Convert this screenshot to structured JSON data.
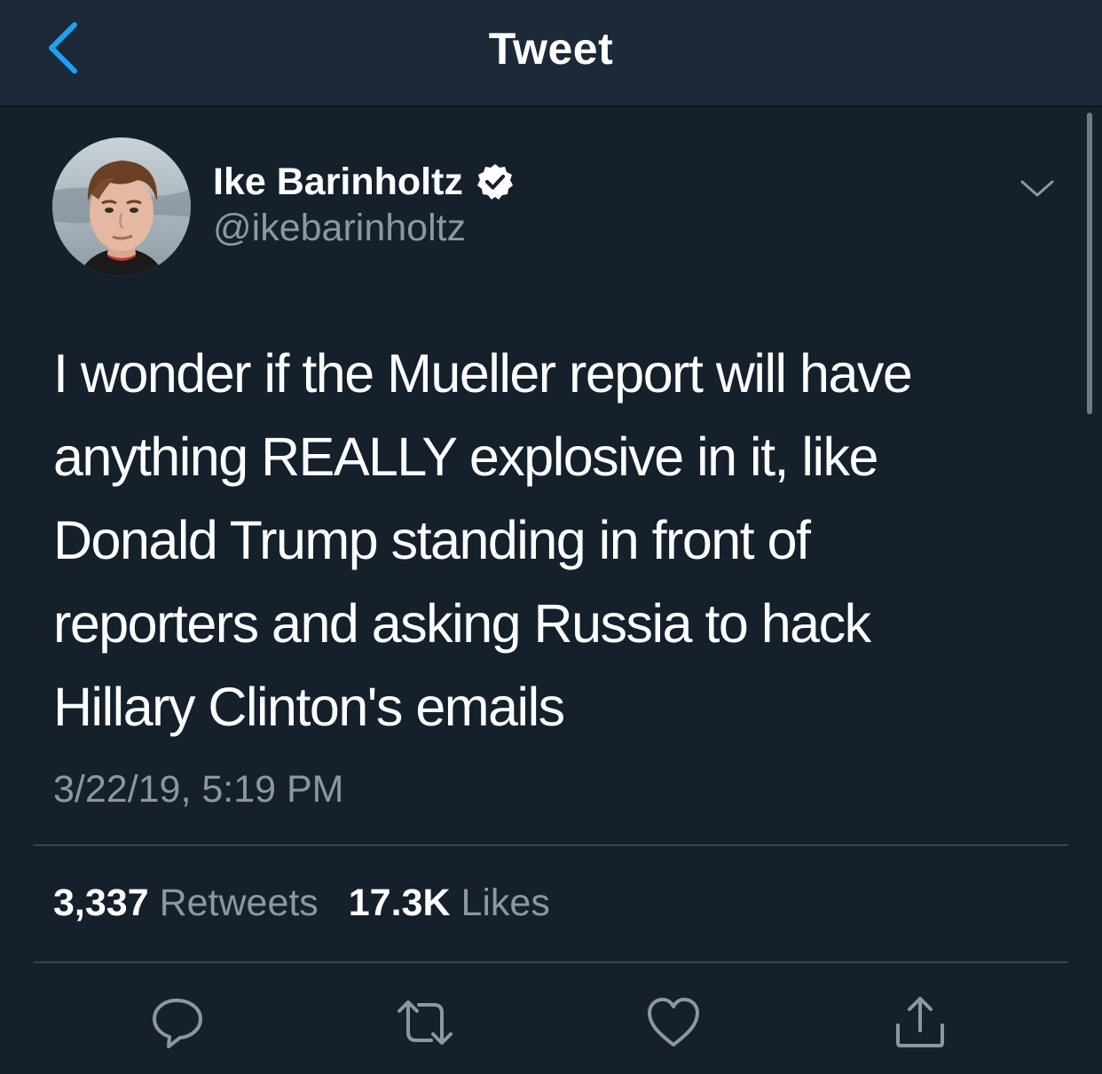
{
  "header": {
    "title": "Tweet",
    "back_icon": "chevron-left-icon",
    "accent_color": "#1da1f2"
  },
  "tweet": {
    "author": {
      "display_name": "Ike Barinholtz",
      "handle": "@ikebarinholtz",
      "verified_icon": "verified-badge-icon"
    },
    "text_lines": [
      "I wonder if the Mueller report will have",
      "anything REALLY explosive in it, like",
      "Donald Trump standing in front of",
      "reporters and asking Russia to hack",
      "Hillary Clinton's emails"
    ],
    "timestamp": "3/22/19, 5:19 PM",
    "stats": {
      "retweets_count": "3,337",
      "retweets_label": "Retweets",
      "likes_count": "17.3K",
      "likes_label": "Likes"
    },
    "actions": [
      "reply-icon",
      "retweet-icon",
      "like-icon",
      "share-icon"
    ]
  },
  "colors": {
    "background": "#15202b",
    "header_background": "#1c2938",
    "secondary_text": "#8899a6",
    "divider": "#38444d"
  }
}
